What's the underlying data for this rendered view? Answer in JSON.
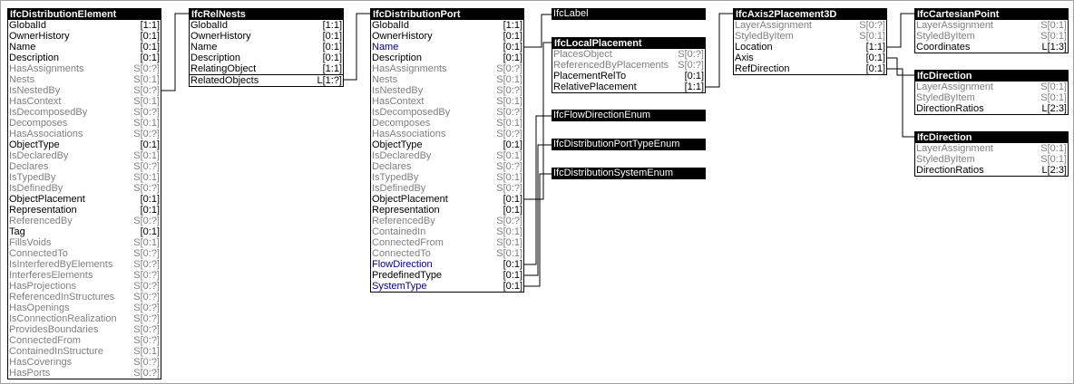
{
  "diagram": {
    "entities": [
      {
        "id": "e1",
        "title": "IfcDistributionElement",
        "attributes": [
          {
            "name": "GlobalId",
            "card": "[1:1]",
            "style": "direct"
          },
          {
            "name": "OwnerHistory",
            "card": "[0:1]",
            "style": "direct"
          },
          {
            "name": "Name",
            "card": "[0:1]",
            "style": "direct"
          },
          {
            "name": "Description",
            "card": "[0:1]",
            "style": "direct"
          },
          {
            "name": "HasAssignments",
            "card": "S[0:?]",
            "style": "inverse"
          },
          {
            "name": "Nests",
            "card": "S[0:1]",
            "style": "inverse"
          },
          {
            "name": "IsNestedBy",
            "card": "S[0:?]",
            "style": "inverse"
          },
          {
            "name": "HasContext",
            "card": "S[0:1]",
            "style": "inverse"
          },
          {
            "name": "IsDecomposedBy",
            "card": "S[0:?]",
            "style": "inverse"
          },
          {
            "name": "Decomposes",
            "card": "S[0:1]",
            "style": "inverse"
          },
          {
            "name": "HasAssociations",
            "card": "S[0:?]",
            "style": "inverse"
          },
          {
            "name": "ObjectType",
            "card": "[0:1]",
            "style": "direct"
          },
          {
            "name": "IsDeclaredBy",
            "card": "S[0:1]",
            "style": "inverse"
          },
          {
            "name": "Declares",
            "card": "S[0:?]",
            "style": "inverse"
          },
          {
            "name": "IsTypedBy",
            "card": "S[0:1]",
            "style": "inverse"
          },
          {
            "name": "IsDefinedBy",
            "card": "S[0:?]",
            "style": "inverse"
          },
          {
            "name": "ObjectPlacement",
            "card": "[0:1]",
            "style": "direct"
          },
          {
            "name": "Representation",
            "card": "[0:1]",
            "style": "direct"
          },
          {
            "name": "ReferencedBy",
            "card": "S[0:?]",
            "style": "inverse"
          },
          {
            "name": "Tag",
            "card": "[0:1]",
            "style": "direct"
          },
          {
            "name": "FillsVoids",
            "card": "S[0:1]",
            "style": "inverse"
          },
          {
            "name": "ConnectedTo",
            "card": "S[0:?]",
            "style": "inverse"
          },
          {
            "name": "IsInterferedByElements",
            "card": "S[0:?]",
            "style": "inverse"
          },
          {
            "name": "InterferesElements",
            "card": "S[0:?]",
            "style": "inverse"
          },
          {
            "name": "HasProjections",
            "card": "S[0:?]",
            "style": "inverse"
          },
          {
            "name": "ReferencedInStructures",
            "card": "S[0:?]",
            "style": "inverse"
          },
          {
            "name": "HasOpenings",
            "card": "S[0:?]",
            "style": "inverse"
          },
          {
            "name": "IsConnectionRealization",
            "card": "S[0:?]",
            "style": "inverse"
          },
          {
            "name": "ProvidesBoundaries",
            "card": "S[0:?]",
            "style": "inverse"
          },
          {
            "name": "ConnectedFrom",
            "card": "S[0:?]",
            "style": "inverse"
          },
          {
            "name": "ContainedInStructure",
            "card": "S[0:1]",
            "style": "inverse"
          },
          {
            "name": "HasCoverings",
            "card": "S[0:?]",
            "style": "inverse"
          },
          {
            "name": "HasPorts",
            "card": "S[0:?]",
            "style": "inverse"
          }
        ]
      },
      {
        "id": "e2",
        "title": "IfcRelNests",
        "attributes": [
          {
            "name": "GlobalId",
            "card": "[1:1]",
            "style": "direct"
          },
          {
            "name": "OwnerHistory",
            "card": "[0:1]",
            "style": "direct"
          },
          {
            "name": "Name",
            "card": "[0:1]",
            "style": "direct"
          },
          {
            "name": "Description",
            "card": "[0:1]",
            "style": "direct"
          },
          {
            "name": "RelatingObject",
            "card": "[1:1]",
            "style": "direct"
          },
          {
            "name": "RelatedObjects",
            "card": "L[1:?]",
            "style": "direct"
          }
        ]
      },
      {
        "id": "e3",
        "title": "IfcDistributionPort",
        "attributes": [
          {
            "name": "GlobalId",
            "card": "[1:1]",
            "style": "direct"
          },
          {
            "name": "OwnerHistory",
            "card": "[0:1]",
            "style": "direct"
          },
          {
            "name": "Name",
            "card": "[0:1]",
            "style": "selected"
          },
          {
            "name": "Description",
            "card": "[0:1]",
            "style": "direct"
          },
          {
            "name": "HasAssignments",
            "card": "S[0:?]",
            "style": "inverse"
          },
          {
            "name": "Nests",
            "card": "S[0:1]",
            "style": "inverse"
          },
          {
            "name": "IsNestedBy",
            "card": "S[0:?]",
            "style": "inverse"
          },
          {
            "name": "HasContext",
            "card": "S[0:1]",
            "style": "inverse"
          },
          {
            "name": "IsDecomposedBy",
            "card": "S[0:?]",
            "style": "inverse"
          },
          {
            "name": "Decomposes",
            "card": "S[0:1]",
            "style": "inverse"
          },
          {
            "name": "HasAssociations",
            "card": "S[0:?]",
            "style": "inverse"
          },
          {
            "name": "ObjectType",
            "card": "[0:1]",
            "style": "direct"
          },
          {
            "name": "IsDeclaredBy",
            "card": "S[0:1]",
            "style": "inverse"
          },
          {
            "name": "Declares",
            "card": "S[0:?]",
            "style": "inverse"
          },
          {
            "name": "IsTypedBy",
            "card": "S[0:1]",
            "style": "inverse"
          },
          {
            "name": "IsDefinedBy",
            "card": "S[0:?]",
            "style": "inverse"
          },
          {
            "name": "ObjectPlacement",
            "card": "[0:1]",
            "style": "direct"
          },
          {
            "name": "Representation",
            "card": "[0:1]",
            "style": "direct"
          },
          {
            "name": "ReferencedBy",
            "card": "S[0:?]",
            "style": "inverse"
          },
          {
            "name": "ContainedIn",
            "card": "S[0:1]",
            "style": "inverse"
          },
          {
            "name": "ConnectedFrom",
            "card": "S[0:1]",
            "style": "inverse"
          },
          {
            "name": "ConnectedTo",
            "card": "S[0:1]",
            "style": "inverse"
          },
          {
            "name": "FlowDirection",
            "card": "[0:1]",
            "style": "selected"
          },
          {
            "name": "PredefinedType",
            "card": "[0:1]",
            "style": "direct"
          },
          {
            "name": "SystemType",
            "card": "[0:1]",
            "style": "selected"
          }
        ]
      },
      {
        "id": "e4",
        "title": "IfcLabel",
        "attributes": []
      },
      {
        "id": "e5",
        "title": "IfcLocalPlacement",
        "attributes": [
          {
            "name": "PlacesObject",
            "card": "S[0:?]",
            "style": "inverse"
          },
          {
            "name": "ReferencedByPlacements",
            "card": "S[0:?]",
            "style": "inverse"
          },
          {
            "name": "PlacementRelTo",
            "card": "[0:1]",
            "style": "direct"
          },
          {
            "name": "RelativePlacement",
            "card": "[1:1]",
            "style": "direct"
          }
        ]
      },
      {
        "id": "e6",
        "title": "IfcFlowDirectionEnum",
        "attributes": []
      },
      {
        "id": "e7",
        "title": "IfcDistributionPortTypeEnum",
        "attributes": []
      },
      {
        "id": "e8",
        "title": "IfcDistributionSystemEnum",
        "attributes": []
      },
      {
        "id": "e9",
        "title": "IfcAxis2Placement3D",
        "attributes": [
          {
            "name": "LayerAssignment",
            "card": "S[0:?]",
            "style": "inverse"
          },
          {
            "name": "StyledByItem",
            "card": "S[0:1]",
            "style": "inverse"
          },
          {
            "name": "Location",
            "card": "[1:1]",
            "style": "direct"
          },
          {
            "name": "Axis",
            "card": "[0:1]",
            "style": "direct"
          },
          {
            "name": "RefDirection",
            "card": "[0:1]",
            "style": "direct"
          }
        ]
      },
      {
        "id": "e10",
        "title": "IfcCartesianPoint",
        "attributes": [
          {
            "name": "LayerAssignment",
            "card": "S[0:1]",
            "style": "inverse"
          },
          {
            "name": "StyledByItem",
            "card": "S[0:1]",
            "style": "inverse"
          },
          {
            "name": "Coordinates",
            "card": "L[1:3]",
            "style": "direct"
          }
        ]
      },
      {
        "id": "e11",
        "title": "IfcDirection",
        "attributes": [
          {
            "name": "LayerAssignment",
            "card": "S[0:1]",
            "style": "inverse"
          },
          {
            "name": "StyledByItem",
            "card": "S[0:1]",
            "style": "inverse"
          },
          {
            "name": "DirectionRatios",
            "card": "L[2:3]",
            "style": "direct"
          }
        ]
      },
      {
        "id": "e12",
        "title": "IfcDirection",
        "attributes": [
          {
            "name": "LayerAssignment",
            "card": "S[0:1]",
            "style": "inverse"
          },
          {
            "name": "StyledByItem",
            "card": "S[0:1]",
            "style": "inverse"
          },
          {
            "name": "DirectionRatios",
            "card": "L[2:3]",
            "style": "direct"
          }
        ]
      }
    ]
  }
}
